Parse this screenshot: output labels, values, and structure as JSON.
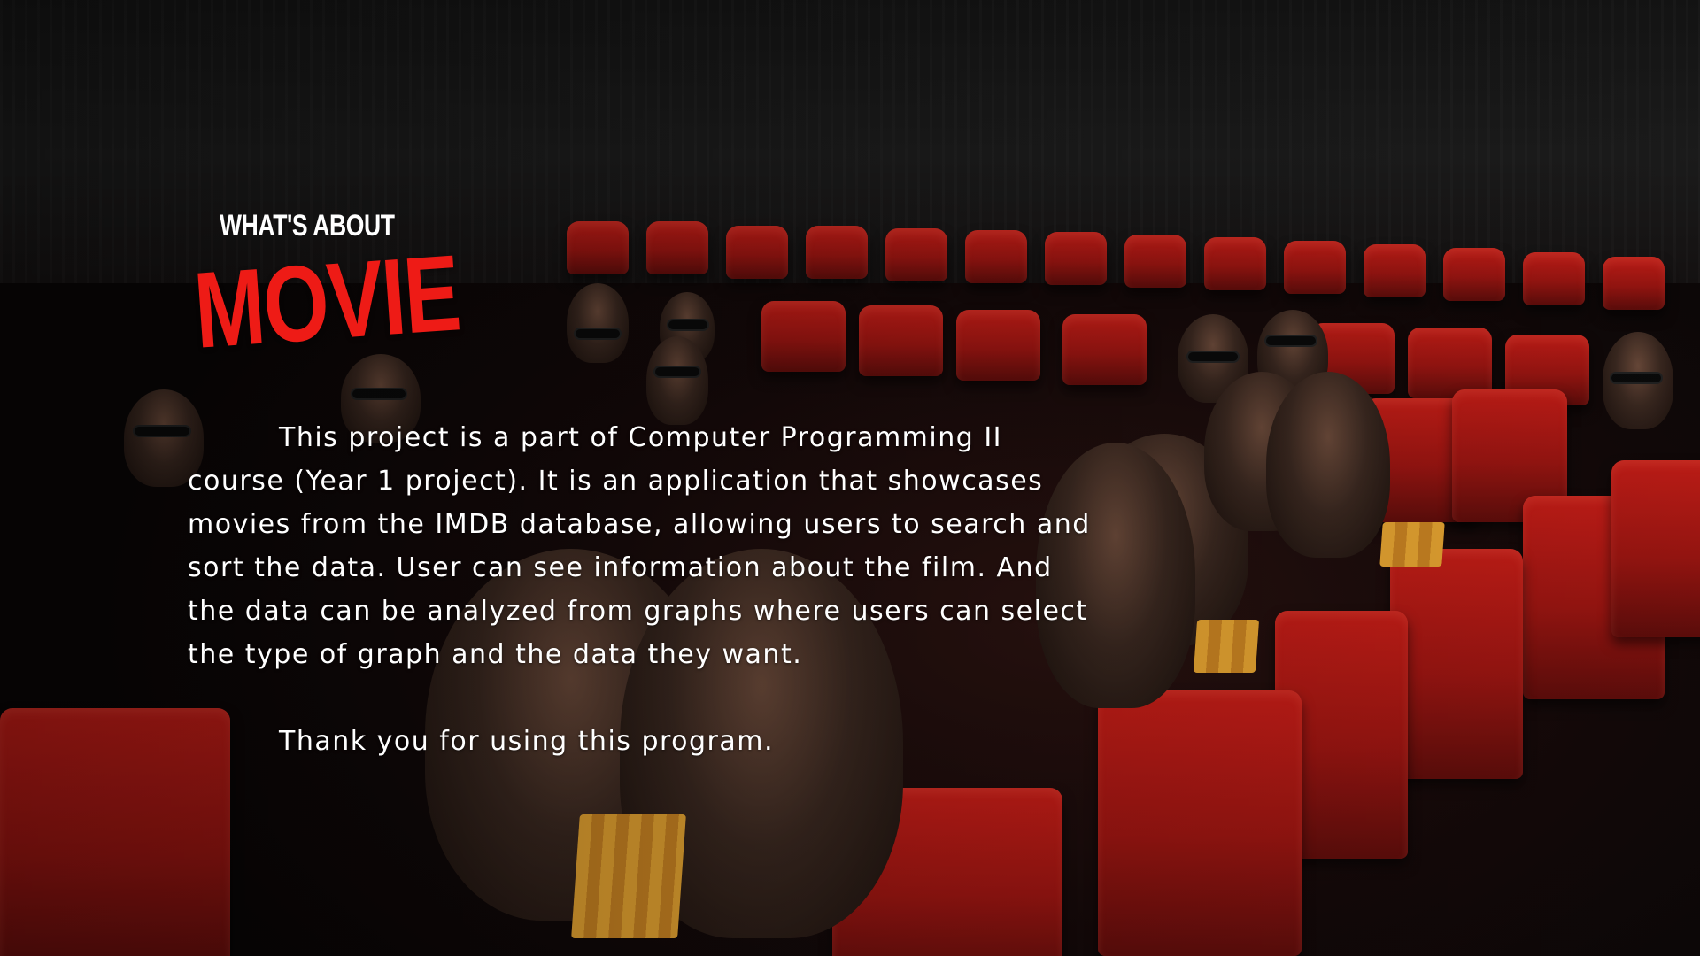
{
  "slide": {
    "kicker": "WHAT'S ABOUT",
    "headline": "MOVIE",
    "description": "This project is a part of Computer Programming II course (Year 1 project). It is an application that showcases movies from the IMDB database, allowing users to search and sort the data. User can see information about the film. And the data can be analyzed from graphs where users can select the type of graph and the data they want.",
    "closing": "Thank you for using this program."
  },
  "colors": {
    "headline": "#ee1b16",
    "text": "#ffffff",
    "seat_red": "#c41d17",
    "background": "#0b0707"
  }
}
